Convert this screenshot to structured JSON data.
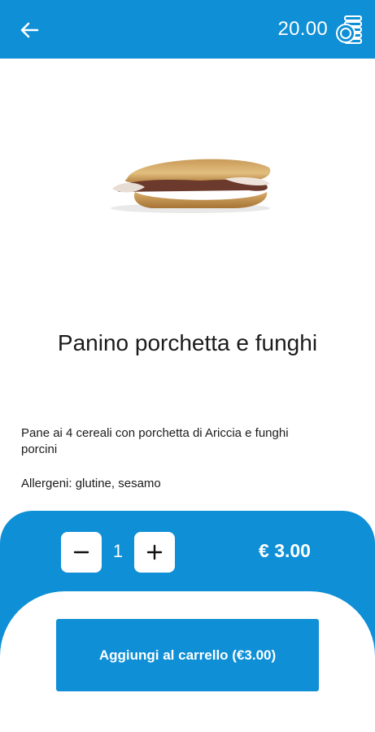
{
  "colors": {
    "primary": "#0f8fd6",
    "background": "#ffffff",
    "text": "#1b1b1b"
  },
  "header": {
    "back_icon": "arrow-left-icon",
    "credit_value": "20.00",
    "credit_icon": "coins-icon"
  },
  "product": {
    "image": "sandwich-photo",
    "name": "Panino porchetta e funghi",
    "description": "Pane ai 4 cereali con porchetta di Ariccia e funghi porcini",
    "allergens": "Allergeni: glutine, sesamo"
  },
  "order": {
    "minus_icon": "minus-icon",
    "plus_icon": "plus-icon",
    "quantity": "1",
    "price": "€ 3.00",
    "add_to_cart_label": "Aggiungi al carrello (€3.00)"
  }
}
